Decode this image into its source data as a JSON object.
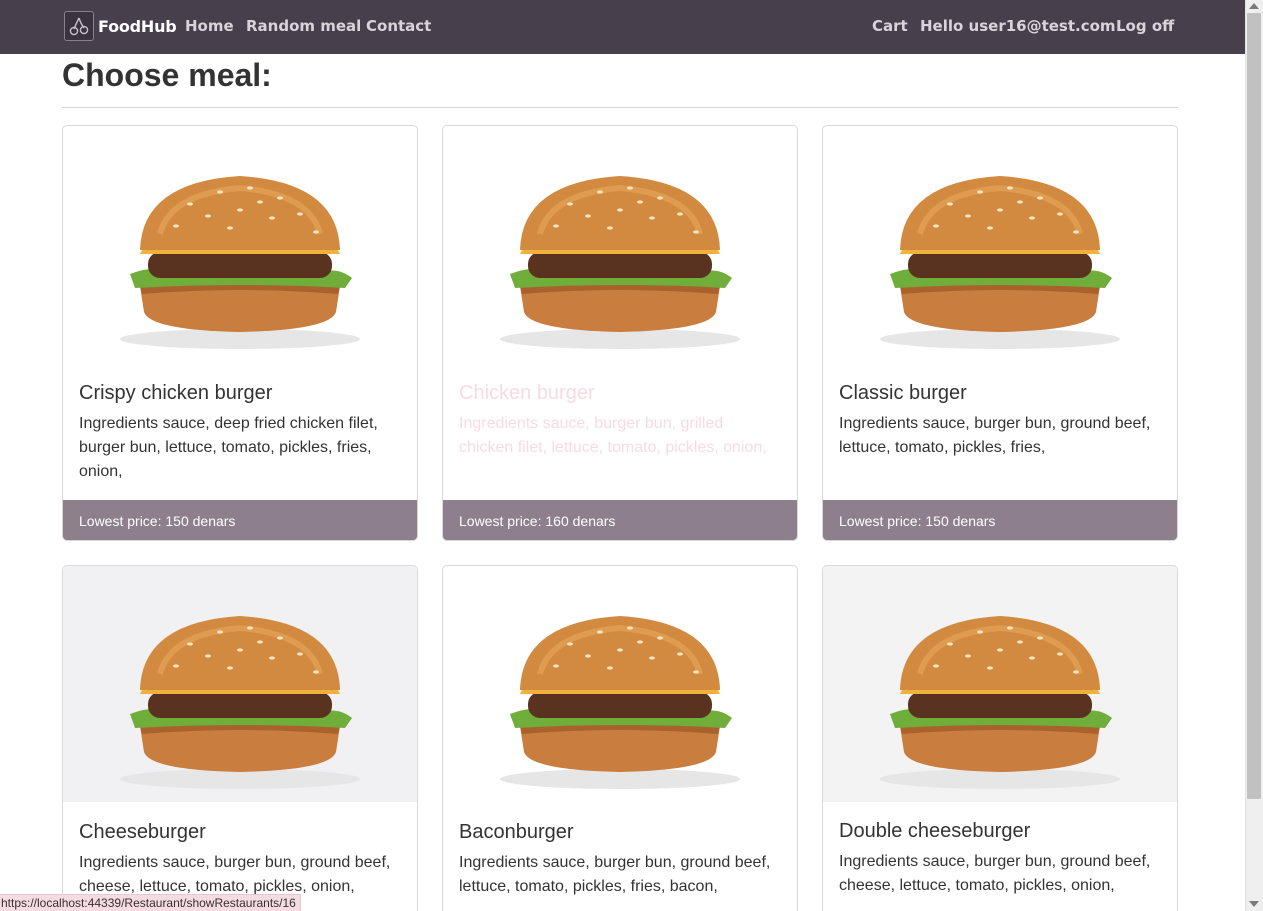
{
  "nav": {
    "brand": "FoodHub",
    "links": [
      "Home",
      "Random meal",
      "Contact"
    ],
    "right": [
      "Cart",
      "Hello user16@test.com!",
      "Log off"
    ]
  },
  "page": {
    "title": "Choose meal:"
  },
  "meals": [
    {
      "name": "Crispy chicken burger",
      "ingredients": "Ingredients sauce, deep fried chicken filet, burger bun, lettuce, tomato, pickles, fries, onion,",
      "price": "Lowest price: 150 denars"
    },
    {
      "name": "Chicken burger",
      "ingredients": "Ingredients sauce, burger bun, grilled chicken filet, lettuce, tomato, pickles, onion,",
      "price": "Lowest price: 160 denars"
    },
    {
      "name": "Classic burger",
      "ingredients": "Ingredients sauce, burger bun, ground beef, lettuce, tomato, pickles, fries,",
      "price": "Lowest price: 150 denars"
    },
    {
      "name": "Cheeseburger",
      "ingredients": "Ingredients sauce, burger bun, ground beef, cheese, lettuce, tomato, pickles, onion,"
    },
    {
      "name": "Baconburger",
      "ingredients": "Ingredients sauce, burger bun, ground beef, lettuce, tomato, pickles, fries, bacon,"
    },
    {
      "name": "Double cheeseburger",
      "ingredients": "Ingredients sauce, burger bun, ground beef, cheese, lettuce, tomato, pickles, onion,"
    }
  ],
  "status_url": "https://localhost:44339/Restaurant/showRestaurants/16"
}
